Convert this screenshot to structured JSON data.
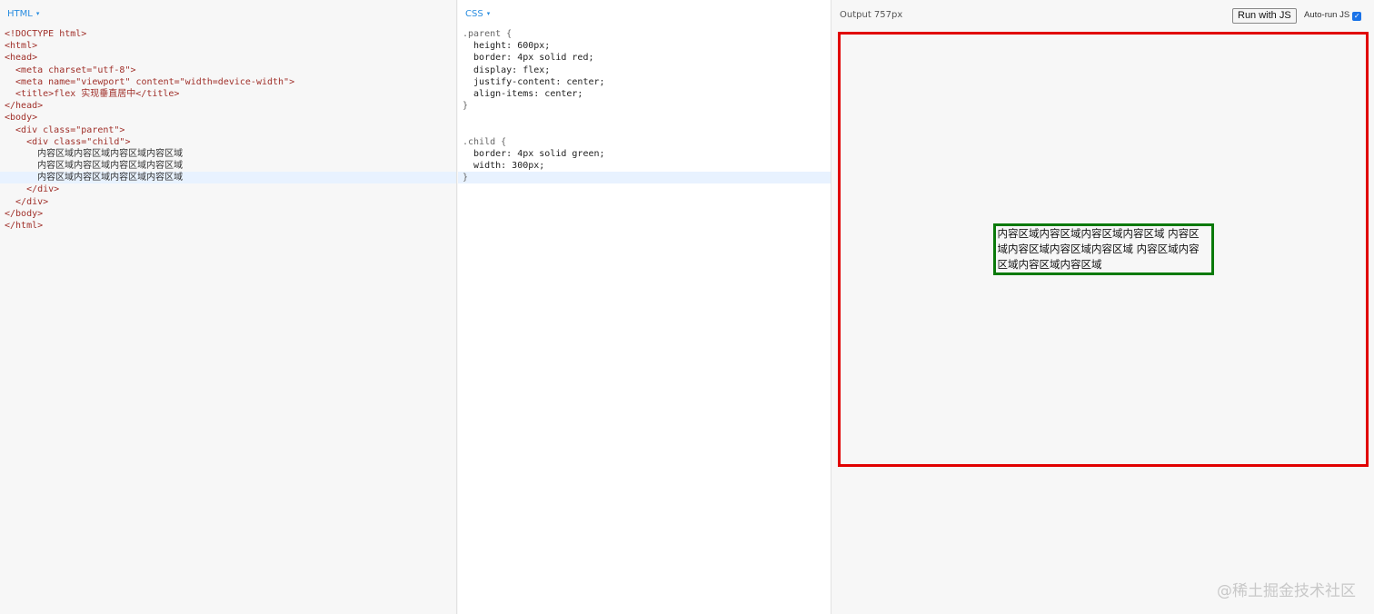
{
  "html_pane": {
    "label": "HTML",
    "caret": "▾",
    "lines": [
      "<!DOCTYPE html>",
      "<html>",
      "<head>",
      "  <meta charset=\"utf-8\">",
      "  <meta name=\"viewport\" content=\"width=device-width\">",
      "  <title>flex 实现垂直居中</title>",
      "</head>",
      "<body>",
      "  <div class=\"parent\">",
      "    <div class=\"child\">",
      "      内容区域内容区域内容区域内容区域",
      "      内容区域内容区域内容区域内容区域",
      "      内容区域内容区域内容区域内容区域",
      "    </div>",
      "  </div>",
      "</body>",
      "</html>"
    ]
  },
  "css_pane": {
    "label": "CSS",
    "caret": "▾",
    "lines": [
      ".parent {",
      "  height: 600px;",
      "  border: 4px solid red;",
      "  display: flex;",
      "  justify-content: center;",
      "  align-items: center;",
      "}",
      "",
      "",
      ".child {",
      "  border: 4px solid green;",
      "  width: 300px;",
      "}"
    ]
  },
  "output": {
    "title": "Output 757px",
    "run_button": "Run with JS",
    "autorun_label": "Auto-run JS",
    "autorun_checked": true,
    "child_text": "内容区域内容区域内容区域内容区域 内容区域内容区域内容区域内容区域 内容区域内容区域内容区域内容区域"
  },
  "watermark": "@稀土掘金技术社区",
  "colors": {
    "parent_border": "#e10000",
    "child_border": "#0a7a0a",
    "accent": "#2a8de0"
  }
}
